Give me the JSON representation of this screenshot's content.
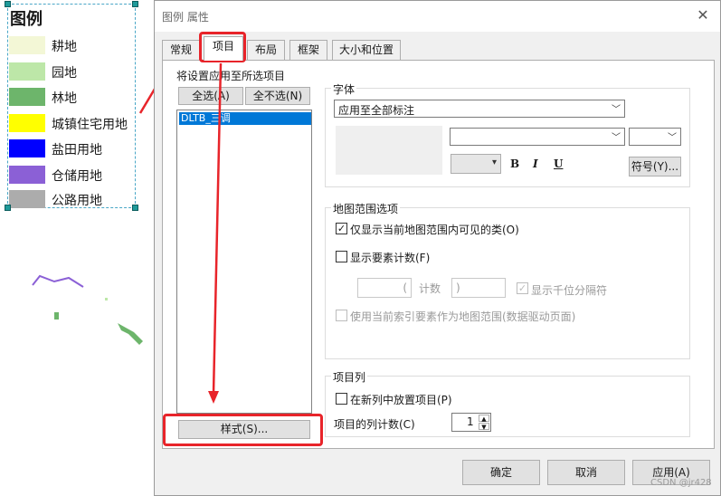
{
  "legend": {
    "title": "图例",
    "items": [
      {
        "label": "耕地",
        "color": "#f3f7d6"
      },
      {
        "label": "园地",
        "color": "#bde7a8"
      },
      {
        "label": "林地",
        "color": "#6db56b"
      },
      {
        "label": "城镇住宅用地",
        "color": "#ffff00"
      },
      {
        "label": "盐田用地",
        "color": "#0000ff"
      },
      {
        "label": "仓储用地",
        "color": "#8b60d6"
      },
      {
        "label": "公路用地",
        "color": "#acacac"
      }
    ]
  },
  "dialog": {
    "title": "图例 属性",
    "close_icon": "close-icon",
    "tabs": [
      "常规",
      "项目",
      "布局",
      "框架",
      "大小和位置"
    ],
    "active_tab": "项目",
    "apply_to_selected_label": "将设置应用至所选项目",
    "select_all_label": "全选(A)",
    "deselect_all_label": "全不选(N)",
    "layer_items": [
      "DLTB_三调"
    ],
    "style_button_label": "样式(S)...",
    "font_group": {
      "title": "字体",
      "apply_mode": "应用至全部标注",
      "bold": "B",
      "italic": "I",
      "underline": "U",
      "symbol_button_label": "符号(Y)..."
    },
    "map_extent_group": {
      "title": "地图范围选项",
      "only_visible_label": "仅显示当前地图范围内可见的类(O)",
      "only_visible_checked": true,
      "show_count_label": "显示要素计数(F)",
      "show_count_checked": false,
      "count_prefix": "(",
      "count_label": "计数",
      "count_suffix": ")",
      "thousands_sep_label": "显示千位分隔符",
      "thousands_sep_checked": true,
      "use_index_label": "使用当前索引要素作为地图范围(数据驱动页面)",
      "use_index_checked": false
    },
    "item_column_group": {
      "title": "项目列",
      "new_column_label": "在新列中放置项目(P)",
      "new_column_checked": false,
      "column_count_label": "项目的列计数(C)",
      "column_count_value": "1"
    },
    "ok_label": "确定",
    "cancel_label": "取消",
    "apply_label": "应用(A)"
  },
  "watermark": "CSDN @jr428"
}
